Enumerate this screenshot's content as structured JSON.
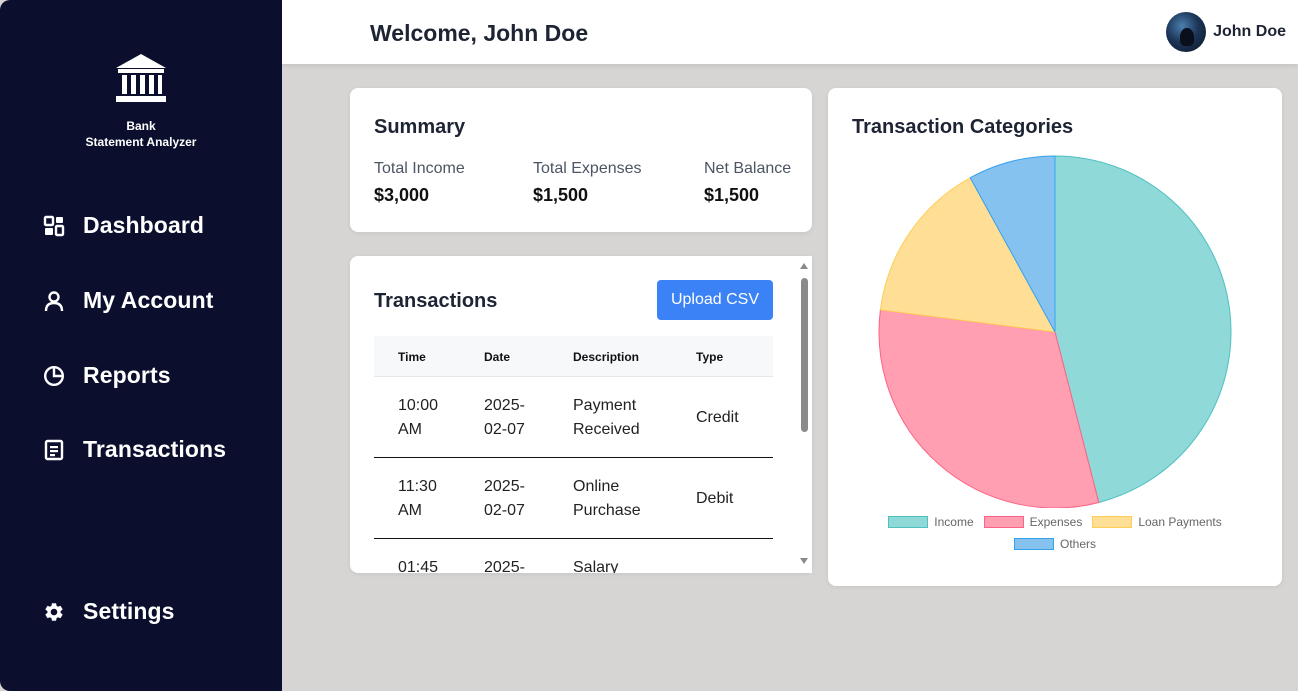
{
  "app": {
    "name_line1": "Bank",
    "name_line2": "Statement Analyzer",
    "logo_icon": "bank-icon"
  },
  "sidebar": {
    "items": [
      {
        "label": "Dashboard",
        "icon": "dashboard-icon"
      },
      {
        "label": "My Account",
        "icon": "user-icon"
      },
      {
        "label": "Reports",
        "icon": "pie-chart-icon"
      },
      {
        "label": "Transactions",
        "icon": "document-icon"
      }
    ],
    "settings": {
      "label": "Settings",
      "icon": "gear-icon"
    }
  },
  "header": {
    "welcome": "Welcome, John Doe",
    "user_name": "John Doe"
  },
  "summary": {
    "title": "Summary",
    "income_label": "Total Income",
    "income_value": "$3,000",
    "expenses_label": "Total Expenses",
    "expenses_value": "$1,500",
    "balance_label": "Net Balance",
    "balance_value": "$1,500"
  },
  "transactions": {
    "title": "Transactions",
    "upload_label": "Upload CSV",
    "columns": [
      "Time",
      "Date",
      "Description",
      "Type"
    ],
    "rows": [
      {
        "time": [
          "10:00",
          "AM"
        ],
        "date": [
          "2025-",
          "02-07"
        ],
        "description": [
          "Payment",
          "Received"
        ],
        "type": "Credit"
      },
      {
        "time": [
          "11:30",
          "AM"
        ],
        "date": [
          "2025-",
          "02-07"
        ],
        "description": [
          "Online",
          "Purchase"
        ],
        "type": "Debit"
      },
      {
        "time": [
          "01:45",
          ""
        ],
        "date": [
          "2025-",
          ""
        ],
        "description": [
          "Salary",
          ""
        ],
        "type": ""
      }
    ]
  },
  "categories": {
    "title": "Transaction Categories"
  },
  "colors": {
    "sidebar_bg": "#0b0f2d",
    "accent": "#3b82f6",
    "income": "#8fd9d9",
    "expenses": "#ff9fb1",
    "loan": "#ffdf96",
    "others": "#86c2f0"
  },
  "chart_data": {
    "type": "pie",
    "title": "Transaction Categories",
    "categories": [
      "Income",
      "Expenses",
      "Loan Payments",
      "Others"
    ],
    "values": [
      46,
      31,
      15,
      8
    ],
    "colors": [
      "#8fd9d9",
      "#ff9fb1",
      "#ffdf96",
      "#86c2f0"
    ],
    "legend_position": "bottom"
  }
}
